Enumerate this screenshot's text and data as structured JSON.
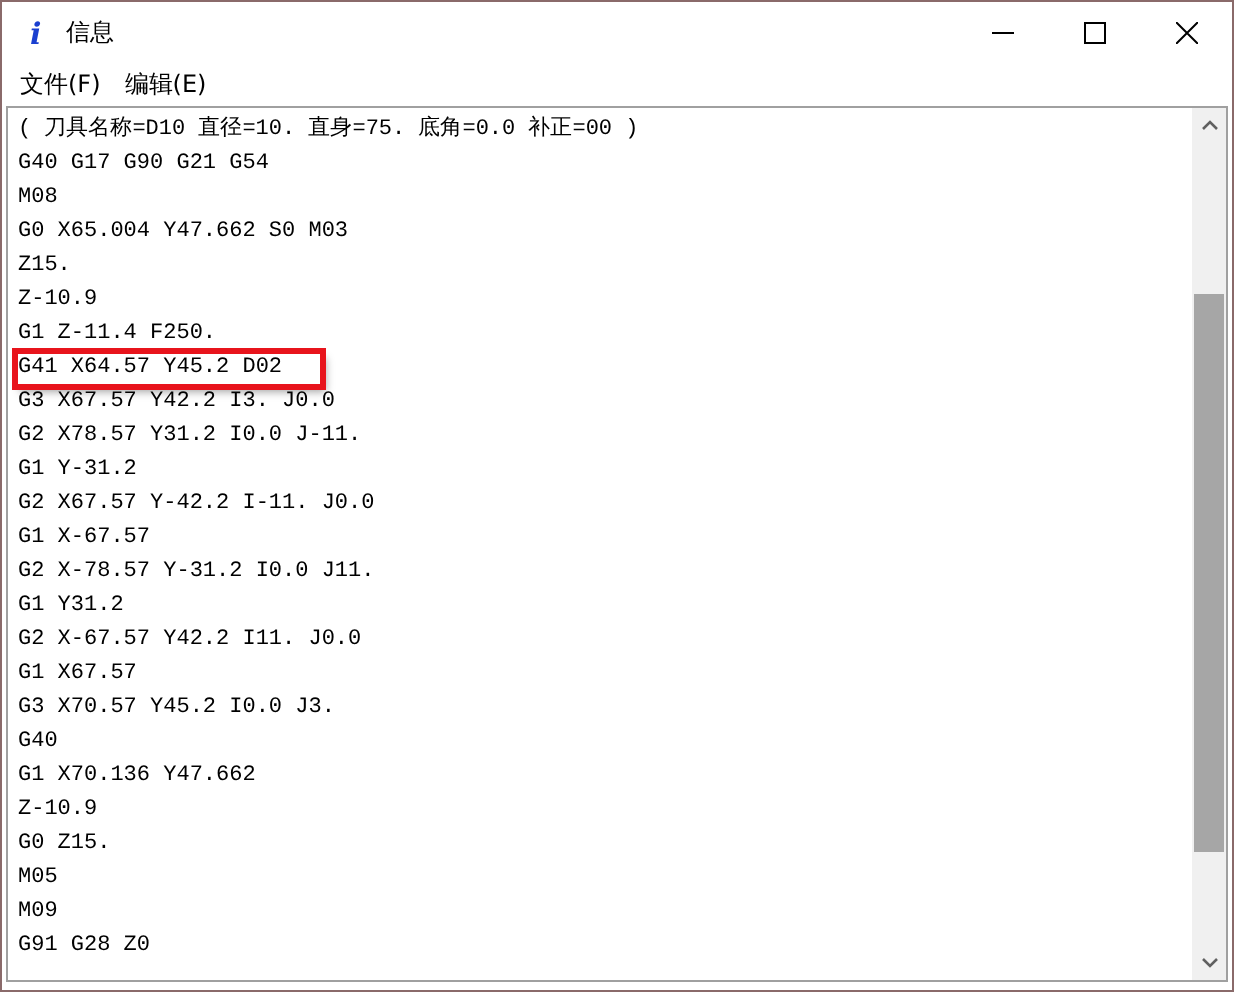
{
  "window": {
    "title": "信息",
    "icon": "i"
  },
  "menu": [
    "文件(F)",
    "编辑(E)"
  ],
  "lines": [
    {
      "text": "( 刀具名称=D10 直径=10. 直身=75. 底角=0.0 补正=00 )",
      "highlighted": false
    },
    {
      "text": "G40 G17 G90 G21 G54",
      "highlighted": false
    },
    {
      "text": "M08",
      "highlighted": false
    },
    {
      "text": "G0 X65.004 Y47.662 S0 M03",
      "highlighted": false
    },
    {
      "text": "Z15.",
      "highlighted": false
    },
    {
      "text": "Z-10.9",
      "highlighted": false
    },
    {
      "text": "G1 Z-11.4 F250.",
      "highlighted": false
    },
    {
      "text": "G41 X64.57 Y45.2 D02",
      "highlighted": true
    },
    {
      "text": "G3 X67.57 Y42.2 I3. J0.0",
      "highlighted": false
    },
    {
      "text": "G2 X78.57 Y31.2 I0.0 J-11.",
      "highlighted": false
    },
    {
      "text": "G1 Y-31.2",
      "highlighted": false
    },
    {
      "text": "G2 X67.57 Y-42.2 I-11. J0.0",
      "highlighted": false
    },
    {
      "text": "G1 X-67.57",
      "highlighted": false
    },
    {
      "text": "G2 X-78.57 Y-31.2 I0.0 J11.",
      "highlighted": false
    },
    {
      "text": "G1 Y31.2",
      "highlighted": false
    },
    {
      "text": "G2 X-67.57 Y42.2 I11. J0.0",
      "highlighted": false
    },
    {
      "text": "G1 X67.57",
      "highlighted": false
    },
    {
      "text": "G3 X70.57 Y45.2 I0.0 J3.",
      "highlighted": false
    },
    {
      "text": "G40",
      "highlighted": false
    },
    {
      "text": "G1 X70.136 Y47.662",
      "highlighted": false
    },
    {
      "text": "Z-10.9",
      "highlighted": false
    },
    {
      "text": "G0 Z15.",
      "highlighted": false
    },
    {
      "text": "M05",
      "highlighted": false
    },
    {
      "text": "M09",
      "highlighted": false
    },
    {
      "text": "G91 G28 Z0",
      "highlighted": false
    }
  ]
}
